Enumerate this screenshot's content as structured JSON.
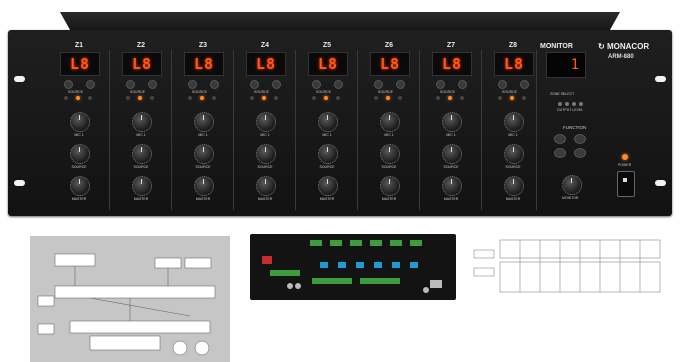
{
  "device": {
    "brand": "MONACOR",
    "model": "ARM-880",
    "monitor_label": "MONITOR",
    "monitor_display": "1",
    "zones": [
      {
        "label": "Z1",
        "display": "L8"
      },
      {
        "label": "Z2",
        "display": "L8"
      },
      {
        "label": "Z3",
        "display": "L8"
      },
      {
        "label": "Z4",
        "display": "L8"
      },
      {
        "label": "Z5",
        "display": "L8"
      },
      {
        "label": "Z6",
        "display": "L8"
      },
      {
        "label": "Z7",
        "display": "L8"
      },
      {
        "label": "Z8",
        "display": "L8"
      }
    ],
    "knob_labels": {
      "mic": "MIC 1",
      "source": "SOURCE",
      "master": "MASTER"
    },
    "source_label": "SOURCE",
    "function_label": "FUNCTION",
    "power_label": "POWER",
    "monitor_knob_label": "MONITOR",
    "zone_select_label": "ZONE SELECT",
    "output_level_label": "OUTPUT LEVEL"
  },
  "colors": {
    "display": "#ff5a12",
    "panel": "#151515",
    "led": "#ff8a2a"
  }
}
